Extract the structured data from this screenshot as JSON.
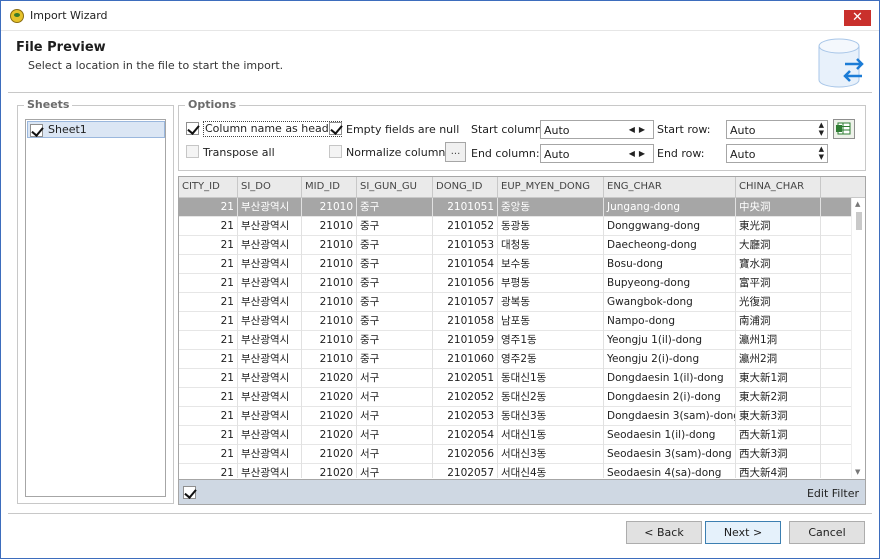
{
  "window": {
    "title": "Import Wizard",
    "close_glyph": "✕"
  },
  "header": {
    "title": "File Preview",
    "subtitle": "Select a location in the file to start the import.",
    "icon": "database-import-icon"
  },
  "sheets": {
    "group_title": "Sheets",
    "items": [
      {
        "label": "Sheet1",
        "checked": true
      }
    ]
  },
  "options": {
    "group_title": "Options",
    "column_name_as_header": {
      "label": "Column name as header",
      "checked": true
    },
    "empty_fields_are_null": {
      "label": "Empty fields are null",
      "checked": true
    },
    "transpose_all": {
      "label": "Transpose all",
      "checked": false
    },
    "normalize_columns": {
      "label": "Normalize columns",
      "checked": false
    },
    "ellipsis_label": "...",
    "start_column": {
      "label": "Start column:",
      "value": "Auto"
    },
    "end_column": {
      "label": "End column:",
      "value": "Auto"
    },
    "start_row": {
      "label": "Start row:",
      "value": "Auto"
    },
    "end_row": {
      "label": "End row:",
      "value": "Auto"
    }
  },
  "grid": {
    "columns": [
      "CITY_ID",
      "SI_DO",
      "MID_ID",
      "SI_GUN_GU",
      "DONG_ID",
      "EUP_MYEN_DONG",
      "ENG_CHAR",
      "CHINA_CHAR"
    ],
    "rows": [
      [
        "21",
        "부산광역시",
        "21010",
        "중구",
        "2101051",
        "중앙동",
        "Jungang-dong",
        "中央洞"
      ],
      [
        "21",
        "부산광역시",
        "21010",
        "중구",
        "2101052",
        "동광동",
        "Donggwang-dong",
        "東光洞"
      ],
      [
        "21",
        "부산광역시",
        "21010",
        "중구",
        "2101053",
        "대청동",
        "Daecheong-dong",
        "大廳洞"
      ],
      [
        "21",
        "부산광역시",
        "21010",
        "중구",
        "2101054",
        "보수동",
        "Bosu-dong",
        "寶水洞"
      ],
      [
        "21",
        "부산광역시",
        "21010",
        "중구",
        "2101056",
        "부평동",
        "Bupyeong-dong",
        "富平洞"
      ],
      [
        "21",
        "부산광역시",
        "21010",
        "중구",
        "2101057",
        "광복동",
        "Gwangbok-dong",
        "光復洞"
      ],
      [
        "21",
        "부산광역시",
        "21010",
        "중구",
        "2101058",
        "남포동",
        "Nampo-dong",
        "南浦洞"
      ],
      [
        "21",
        "부산광역시",
        "21010",
        "중구",
        "2101059",
        "영주1동",
        "Yeongju 1(il)-dong",
        "瀛州1洞"
      ],
      [
        "21",
        "부산광역시",
        "21010",
        "중구",
        "2101060",
        "영주2동",
        "Yeongju 2(i)-dong",
        "瀛州2洞"
      ],
      [
        "21",
        "부산광역시",
        "21020",
        "서구",
        "2102051",
        "동대신1동",
        "Dongdaesin 1(il)-dong",
        "東大新1洞"
      ],
      [
        "21",
        "부산광역시",
        "21020",
        "서구",
        "2102052",
        "동대신2동",
        "Dongdaesin 2(i)-dong",
        "東大新2洞"
      ],
      [
        "21",
        "부산광역시",
        "21020",
        "서구",
        "2102053",
        "동대신3동",
        "Dongdaesin 3(sam)-dong",
        "東大新3洞"
      ],
      [
        "21",
        "부산광역시",
        "21020",
        "서구",
        "2102054",
        "서대신1동",
        "Seodaesin 1(il)-dong",
        "西大新1洞"
      ],
      [
        "21",
        "부산광역시",
        "21020",
        "서구",
        "2102056",
        "서대신3동",
        "Seodaesin 3(sam)-dong",
        "西大新3洞"
      ],
      [
        "21",
        "부산광역시",
        "21020",
        "서구",
        "2102057",
        "서대신4동",
        "Seodaesin 4(sa)-dong",
        "西大新4洞"
      ]
    ],
    "selected_row": 0,
    "footer_checked": true,
    "edit_filter_label": "Edit Filter"
  },
  "buttons": {
    "back": "< Back",
    "next": "Next >",
    "cancel": "Cancel"
  },
  "colors": {
    "selected_row": "#a6a6a6",
    "header_bg": "#eaeaea",
    "footer_bg": "#cfd8e3",
    "accent": "#1c7cd6"
  }
}
